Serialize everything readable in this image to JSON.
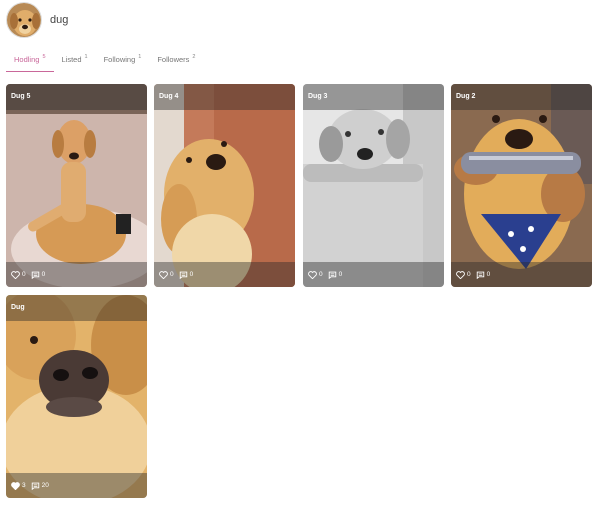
{
  "profile": {
    "username": "dug"
  },
  "tabs": [
    {
      "label": "Hodling",
      "count": "5"
    },
    {
      "label": "Listed",
      "count": "1"
    },
    {
      "label": "Following",
      "count": "1"
    },
    {
      "label": "Followers",
      "count": "2"
    }
  ],
  "cards": [
    {
      "title": "Dug 5",
      "likes": "0",
      "comments": "0"
    },
    {
      "title": "Dug 4",
      "likes": "0",
      "comments": "0"
    },
    {
      "title": "Dug 3",
      "likes": "0",
      "comments": "0"
    },
    {
      "title": "Dug 2",
      "likes": "0",
      "comments": "0"
    },
    {
      "title": "Dug",
      "likes": "3",
      "comments": "20"
    }
  ],
  "icons": {
    "like": "heart-icon",
    "comment": "comment-icon"
  },
  "colors": {
    "accent": "#c9679a"
  }
}
